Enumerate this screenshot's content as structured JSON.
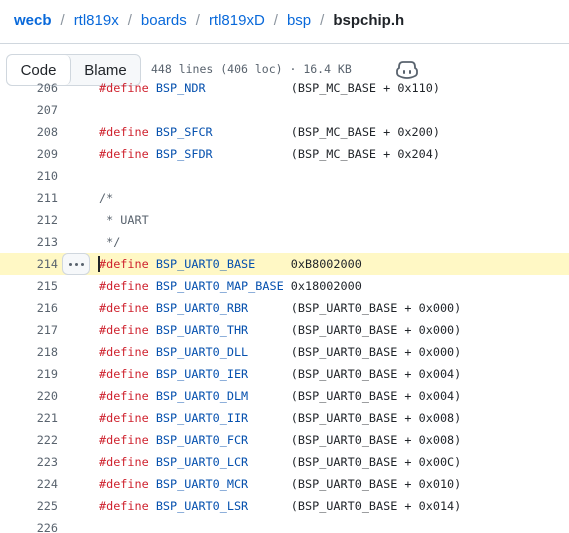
{
  "breadcrumb": {
    "parts": [
      "wecb",
      "rtl819x",
      "boards",
      "rtl819xD",
      "bsp"
    ],
    "current": "bspchip.h",
    "separator": "/"
  },
  "toolbar": {
    "code_label": "Code",
    "blame_label": "Blame",
    "file_info": "448 lines (406 loc) · 16.4 KB",
    "copilot_icon": "copilot-icon"
  },
  "code": {
    "highlighted_line": "214",
    "lines": [
      {
        "num": "206",
        "kind": "define",
        "macro": "BSP_NDR",
        "value": "(BSP_MC_BASE + 0x110)"
      },
      {
        "num": "207",
        "kind": "blank"
      },
      {
        "num": "208",
        "kind": "define",
        "macro": "BSP_SFCR",
        "value": "(BSP_MC_BASE + 0x200)"
      },
      {
        "num": "209",
        "kind": "define",
        "macro": "BSP_SFDR",
        "value": "(BSP_MC_BASE + 0x204)"
      },
      {
        "num": "210",
        "kind": "blank"
      },
      {
        "num": "211",
        "kind": "comment",
        "text": "/*"
      },
      {
        "num": "212",
        "kind": "comment",
        "text": " * UART"
      },
      {
        "num": "213",
        "kind": "comment",
        "text": " */"
      },
      {
        "num": "214",
        "kind": "define",
        "macro": "BSP_UART0_BASE",
        "value": "0xB8002000"
      },
      {
        "num": "215",
        "kind": "define",
        "macro": "BSP_UART0_MAP_BASE",
        "value": "0x18002000"
      },
      {
        "num": "216",
        "kind": "define",
        "macro": "BSP_UART0_RBR",
        "value": "(BSP_UART0_BASE + 0x000)"
      },
      {
        "num": "217",
        "kind": "define",
        "macro": "BSP_UART0_THR",
        "value": "(BSP_UART0_BASE + 0x000)"
      },
      {
        "num": "218",
        "kind": "define",
        "macro": "BSP_UART0_DLL",
        "value": "(BSP_UART0_BASE + 0x000)"
      },
      {
        "num": "219",
        "kind": "define",
        "macro": "BSP_UART0_IER",
        "value": "(BSP_UART0_BASE + 0x004)"
      },
      {
        "num": "220",
        "kind": "define",
        "macro": "BSP_UART0_DLM",
        "value": "(BSP_UART0_BASE + 0x004)"
      },
      {
        "num": "221",
        "kind": "define",
        "macro": "BSP_UART0_IIR",
        "value": "(BSP_UART0_BASE + 0x008)"
      },
      {
        "num": "222",
        "kind": "define",
        "macro": "BSP_UART0_FCR",
        "value": "(BSP_UART0_BASE + 0x008)"
      },
      {
        "num": "223",
        "kind": "define",
        "macro": "BSP_UART0_LCR",
        "value": "(BSP_UART0_BASE + 0x00C)"
      },
      {
        "num": "224",
        "kind": "define",
        "macro": "BSP_UART0_MCR",
        "value": "(BSP_UART0_BASE + 0x010)"
      },
      {
        "num": "225",
        "kind": "define",
        "macro": "BSP_UART0_LSR",
        "value": "(BSP_UART0_BASE + 0x014)"
      },
      {
        "num": "226",
        "kind": "blank"
      }
    ]
  },
  "colors": {
    "link": "#0969da",
    "keyword": "#cf222e",
    "macro": "#0550ae",
    "highlight": "#fff8c5",
    "line_number": "#59636e"
  }
}
